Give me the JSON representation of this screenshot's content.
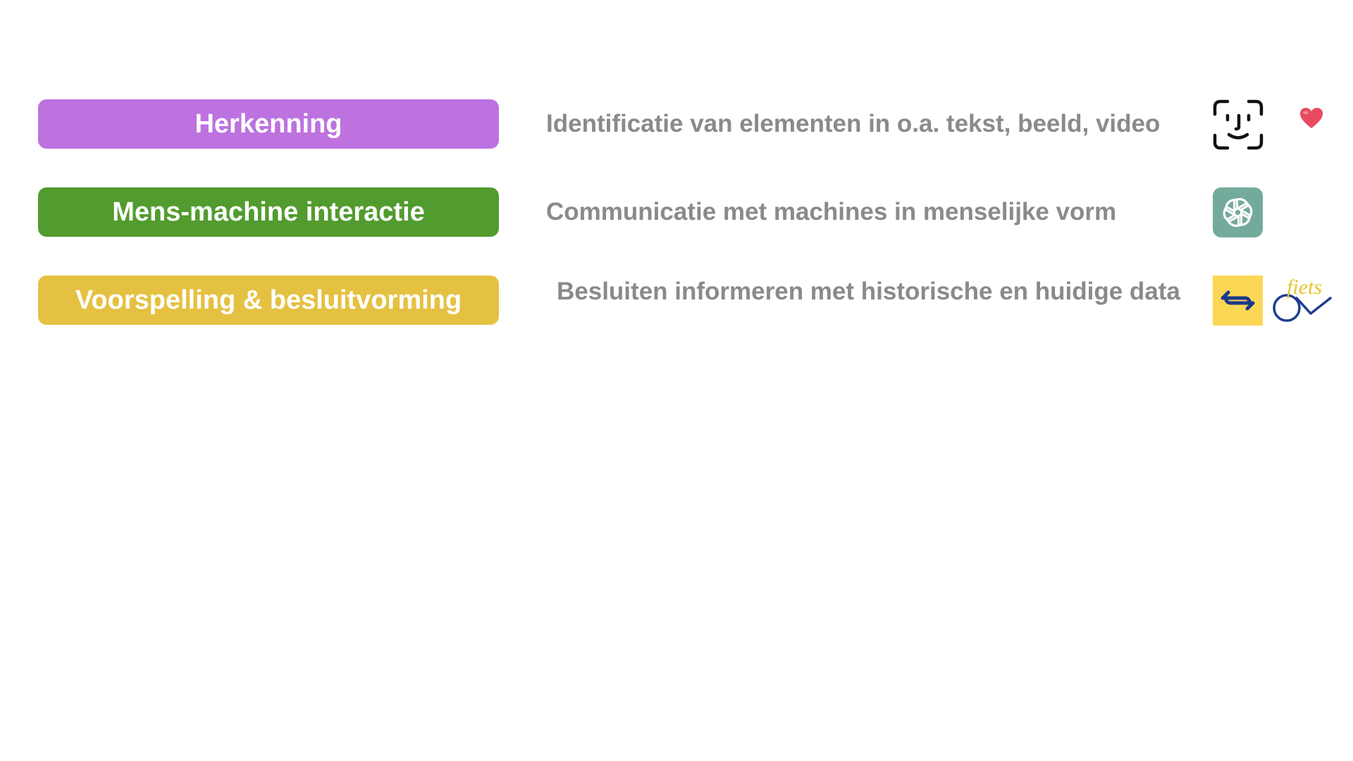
{
  "rows": [
    {
      "label": "Herkenning",
      "description": "Identificatie van elementen in o.a. tekst, beeld, video",
      "color": "#bd72e0",
      "icons": [
        "face-id-icon",
        "heart-icon"
      ]
    },
    {
      "label": "Mens-machine interactie",
      "description": "Communicatie met machines in menselijke vorm",
      "color": "#529b2e",
      "icons": [
        "openai-logo-icon"
      ]
    },
    {
      "label": "Voorspelling & besluitvorming",
      "description": "Besluiten informeren met historische en huidige data",
      "color": "#e5c142",
      "icons": [
        "ns-logo-icon",
        "ov-fiets-logo-icon"
      ]
    }
  ],
  "logos": {
    "ov_fiets_text": "fiets"
  },
  "colors": {
    "description_text": "#8a8a8a",
    "heart": "#e84a5f",
    "openai_bg": "#74aa9c",
    "ns_bg": "#fcd755",
    "ns_arrows": "#1a3a8c",
    "ov_fiets_blue": "#1f3f8f",
    "ov_fiets_yellow": "#e8c32a"
  }
}
